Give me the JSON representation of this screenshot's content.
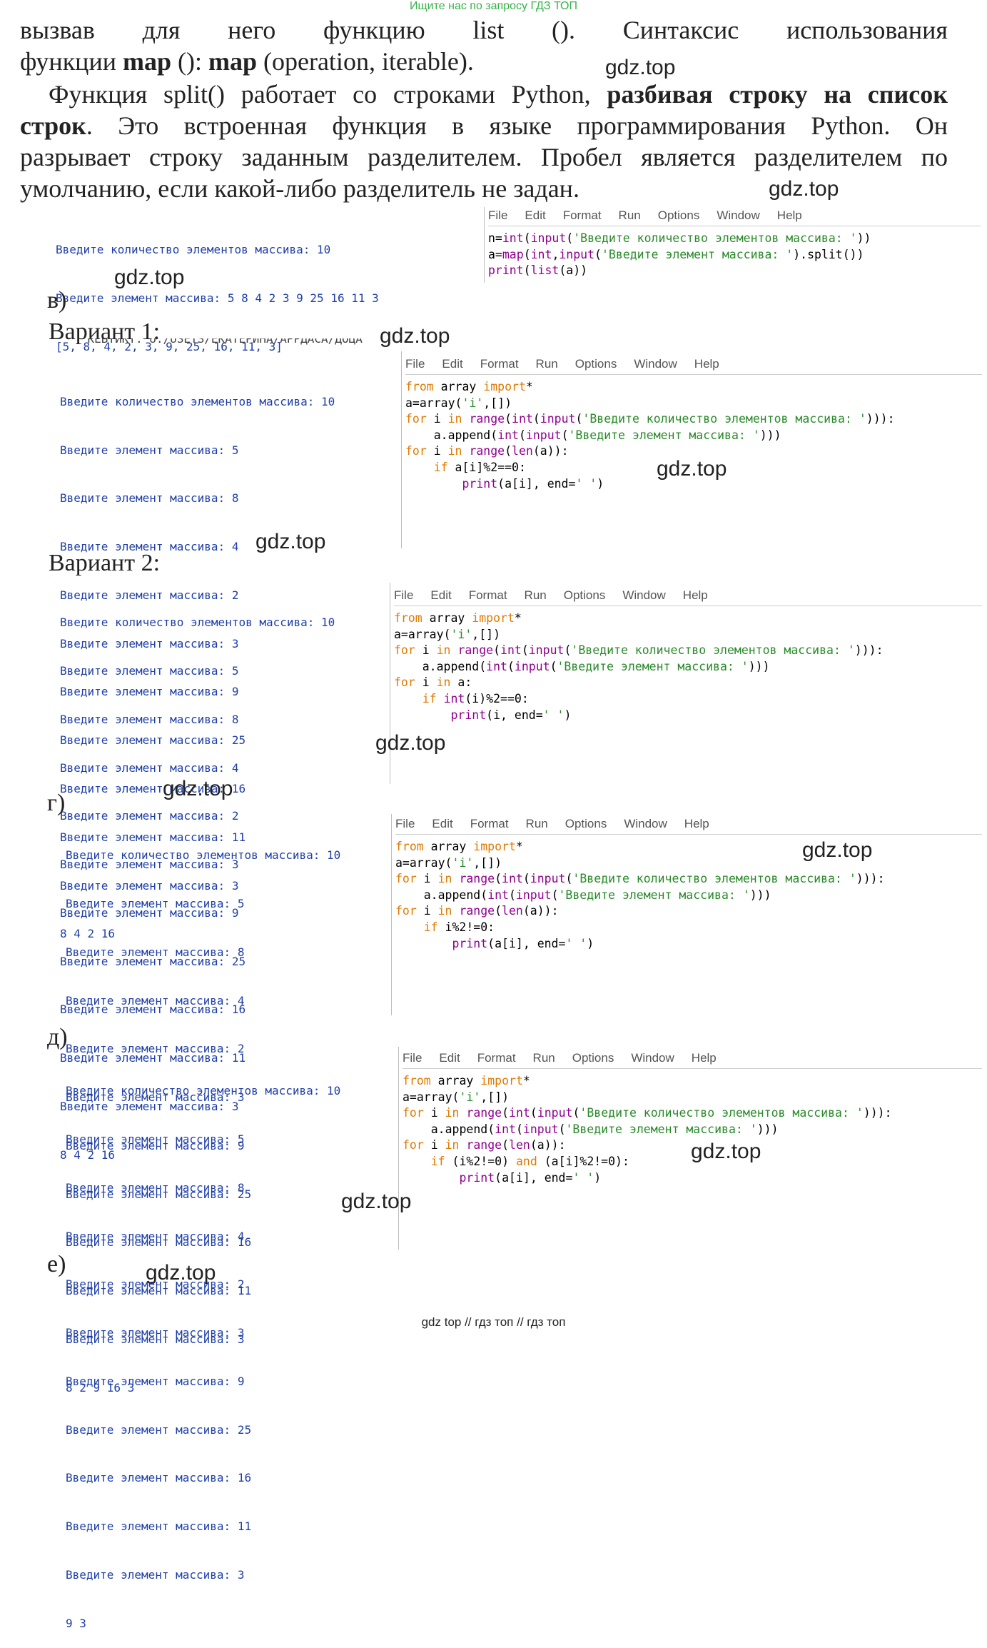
{
  "banner": "Ищите нас по запросу ГДЗ ТОП",
  "watermark": "gdz.top",
  "footer": "gdz top  //  гдз топ  //  гдз топ",
  "para1": {
    "line1": [
      "вызвав",
      "для",
      "него",
      "функцию",
      "list",
      "().",
      "Синтаксис",
      "использования"
    ],
    "line2_a": "функции ",
    "line2_b": "map",
    "line2_c": " (): ",
    "line2_d": "map",
    "line2_e": " (operation, iterable)."
  },
  "para2": {
    "line1_a": "Функция split() работает со строками Python, ",
    "line1_b": "разбивая строку на список",
    "line2_b": "строк",
    "line2_a": ". Это встроенная функция в языке программирования Python. Он",
    "line3": "разрывает строку заданным разделителем. Пробел является разделителем по",
    "line4": "умолчанию, если какой-либо разделитель не задан."
  },
  "menu": [
    "File",
    "Edit",
    "Format",
    "Run",
    "Options",
    "Window",
    "Help"
  ],
  "labels": {
    "v": "в)",
    "var1": "Вариант 1:",
    "var2": "Вариант 2:",
    "g": "г)",
    "d": "д)",
    "e": "е)"
  },
  "shell_partial_path": "    КЕВТИКТ. U:/USETS/ЕКАТЕРИНА/АРРДАСА/ДОЦА",
  "shell_v": [
    "Введите количество элементов массива: 10",
    "Введите элемент массива: 5 8 4 2 3 9 25 16 11 3",
    "[5, 8, 4, 2, 3, 9, 25, 16, 11, 3]"
  ],
  "shell_full": [
    "Введите количество элементов массива: 10",
    "Введите элемент массива: 5",
    "Введите элемент массива: 8",
    "Введите элемент массива: 4",
    "Введите элемент массива: 2",
    "Введите элемент массива: 3",
    "Введите элемент массива: 9",
    "Введите элемент массива: 25",
    "Введите элемент массива: 16",
    "Введите элемент массива: 11",
    "Введите элемент массива: 3"
  ],
  "results": {
    "var1": "8 4 2 16",
    "var2": "8 4 2 16",
    "g": "8 2 9 16 3",
    "d": "9 3"
  }
}
